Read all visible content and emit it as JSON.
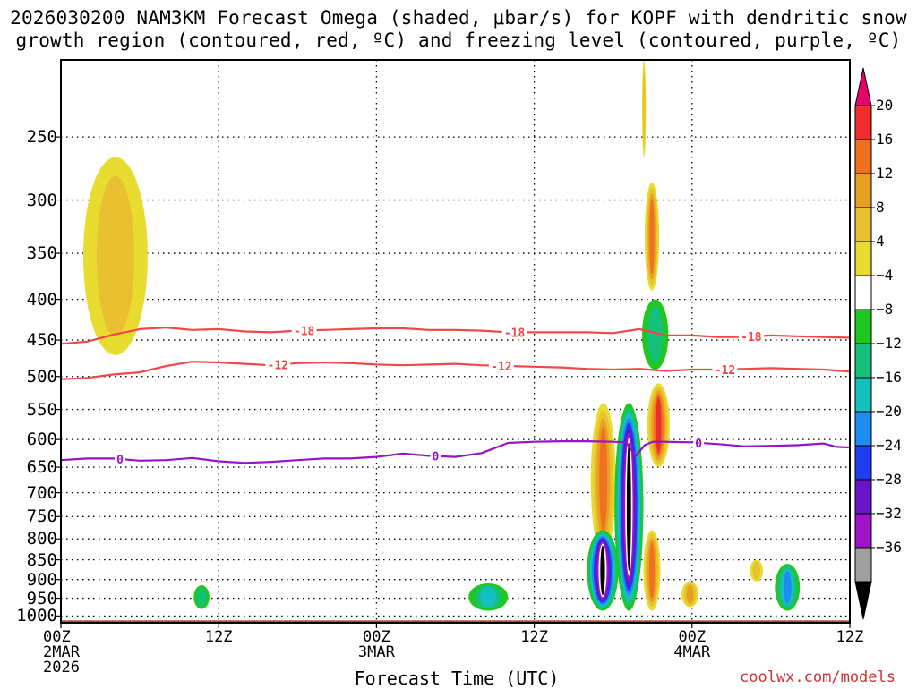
{
  "title_line1": "2026030200 NAM3KM Forecast Omega (shaded, μbar/s) for KOPF with dendritic snow",
  "title_line2": "growth region (contoured, red, ºC) and freezing level (contoured, purple, ºC)",
  "watermark": "coolwx.com/models",
  "chart_data": {
    "type": "heatmap",
    "title": "2026030200 NAM3KM Forecast Omega (shaded, μbar/s) for KOPF with dendritic snow growth region (contoured, red, ºC) and freezing level (contoured, purple, ºC)",
    "xlabel": "Forecast Time (UTC)",
    "ylabel": "",
    "x_range_hours": [
      0,
      60
    ],
    "y_range_hpa": [
      1020,
      200
    ],
    "y_scale": "log-pressure",
    "x_ticks": [
      {
        "hour": 0,
        "lines": [
          "00Z",
          "2MAR",
          "2026"
        ]
      },
      {
        "hour": 12,
        "lines": [
          "12Z"
        ]
      },
      {
        "hour": 24,
        "lines": [
          "00Z",
          "3MAR"
        ]
      },
      {
        "hour": 36,
        "lines": [
          "12Z"
        ]
      },
      {
        "hour": 48,
        "lines": [
          "00Z",
          "4MAR"
        ]
      },
      {
        "hour": 60,
        "lines": [
          "12Z"
        ]
      }
    ],
    "y_ticks": [
      250,
      300,
      350,
      400,
      450,
      500,
      550,
      600,
      650,
      700,
      750,
      800,
      850,
      900,
      950,
      1000
    ],
    "grid": true,
    "colorbar": {
      "labels": [
        "20",
        "16",
        "12",
        "8",
        "4",
        "−4",
        "−8",
        "−12",
        "−16",
        "−20",
        "−24",
        "−28",
        "−32",
        "−36"
      ],
      "colors": [
        "#e8006a",
        "#f02c2c",
        "#f07020",
        "#e8a020",
        "#e8c030",
        "#e8dc30",
        "#ffffff",
        "#1ec81e",
        "#16c07a",
        "#14c0c0",
        "#1e8cf0",
        "#1e3cf0",
        "#6a14c8",
        "#a014c8",
        "#a0a0a0",
        "#000000"
      ]
    },
    "contour_lines": [
      {
        "label": "-18",
        "color": "#f04848",
        "label_positions_hour": [
          18.5,
          34.5,
          52.5
        ],
        "x": [
          0,
          2,
          4,
          6,
          8,
          10,
          12,
          14,
          16,
          18,
          20,
          22,
          24,
          26,
          28,
          30,
          32,
          34,
          36,
          38,
          40,
          42,
          44,
          46,
          48,
          50,
          52,
          54,
          56,
          58,
          60
        ],
        "y": [
          455,
          452,
          443,
          436,
          434,
          437,
          436,
          439,
          440,
          438,
          437,
          436,
          435,
          435,
          437,
          437,
          438,
          440,
          440,
          440,
          440,
          441,
          436,
          444,
          444,
          446,
          446,
          444,
          445,
          446,
          447
        ]
      },
      {
        "label": "-12",
        "color": "#f04848",
        "label_positions_hour": [
          16.5,
          33.5,
          50.5
        ],
        "x": [
          0,
          2,
          4,
          6,
          8,
          10,
          12,
          14,
          16,
          18,
          20,
          22,
          24,
          26,
          28,
          30,
          32,
          34,
          36,
          38,
          40,
          42,
          44,
          46,
          48,
          50,
          52,
          54,
          56,
          58,
          60
        ],
        "y": [
          504,
          502,
          497,
          494,
          485,
          479,
          480,
          482,
          484,
          481,
          480,
          481,
          483,
          484,
          483,
          482,
          484,
          485,
          486,
          487,
          489,
          490,
          489,
          492,
          490,
          490,
          489,
          488,
          489,
          490,
          493
        ]
      },
      {
        "label": "0",
        "color": "#9414c8",
        "label_positions_hour": [
          4.5,
          28.5,
          48.5
        ],
        "x": [
          0,
          2,
          4,
          6,
          8,
          10,
          12,
          14,
          16,
          18,
          20,
          22,
          24,
          26,
          28,
          30,
          32,
          34,
          36,
          38,
          40,
          42,
          43,
          43.7,
          44.4,
          45,
          46,
          48,
          50,
          52,
          54,
          56,
          58,
          59,
          60
        ],
        "y": [
          637,
          634,
          634,
          638,
          637,
          633,
          639,
          642,
          640,
          637,
          634,
          634,
          631,
          625,
          629,
          631,
          624,
          606,
          604,
          603,
          603,
          604,
          605,
          630,
          610,
          604,
          604,
          605,
          608,
          612,
          611,
          610,
          607,
          613,
          614
        ]
      }
    ],
    "surface_band": {
      "label": "surface",
      "color": "#a0522d",
      "pressure_hpa": 1013
    },
    "omega_features": [
      {
        "sign": "positive",
        "peak_ubar_s": 6,
        "hour_range": [
          1.7,
          6.6
        ],
        "pressure_range_hpa": [
          265,
          470
        ]
      },
      {
        "sign": "positive",
        "peak_ubar_s": 6,
        "hour_range": [
          44.2,
          44.5
        ],
        "pressure_range_hpa": [
          200,
          265
        ]
      },
      {
        "sign": "positive",
        "peak_ubar_s": 14,
        "hour_range": [
          44.4,
          45.5
        ],
        "pressure_range_hpa": [
          285,
          390
        ]
      },
      {
        "sign": "negative",
        "peak_ubar_s": -10,
        "hour_range": [
          44.2,
          46.2
        ],
        "pressure_range_hpa": [
          400,
          490
        ]
      },
      {
        "sign": "positive",
        "peak_ubar_s": 20,
        "hour_range": [
          44.6,
          46.3
        ],
        "pressure_range_hpa": [
          510,
          650
        ]
      },
      {
        "sign": "positive",
        "peak_ubar_s": 14,
        "hour_range": [
          40.3,
          42.2
        ],
        "pressure_range_hpa": [
          540,
          840
        ]
      },
      {
        "sign": "negative",
        "peak_ubar_s": -36,
        "hour_range": [
          42.1,
          44.3
        ],
        "pressure_range_hpa": [
          540,
          985
        ]
      },
      {
        "sign": "negative",
        "peak_ubar_s": -36,
        "hour_range": [
          40.0,
          42.4
        ],
        "pressure_range_hpa": [
          780,
          985
        ]
      },
      {
        "sign": "positive",
        "peak_ubar_s": 14,
        "hour_range": [
          44.3,
          45.6
        ],
        "pressure_range_hpa": [
          780,
          985
        ]
      },
      {
        "sign": "negative",
        "peak_ubar_s": -20,
        "hour_range": [
          54.3,
          56.2
        ],
        "pressure_range_hpa": [
          860,
          985
        ]
      },
      {
        "sign": "negative",
        "peak_ubar_s": -14,
        "hour_range": [
          31.0,
          34.0
        ],
        "pressure_range_hpa": [
          910,
          985
        ]
      },
      {
        "sign": "negative",
        "peak_ubar_s": -12,
        "hour_range": [
          10.1,
          11.3
        ],
        "pressure_range_hpa": [
          915,
          980
        ]
      },
      {
        "sign": "positive",
        "peak_ubar_s": 10,
        "hour_range": [
          47.2,
          48.5
        ],
        "pressure_range_hpa": [
          905,
          975
        ]
      },
      {
        "sign": "positive",
        "peak_ubar_s": 6,
        "hour_range": [
          52.4,
          53.4
        ],
        "pressure_range_hpa": [
          850,
          905
        ]
      }
    ]
  }
}
